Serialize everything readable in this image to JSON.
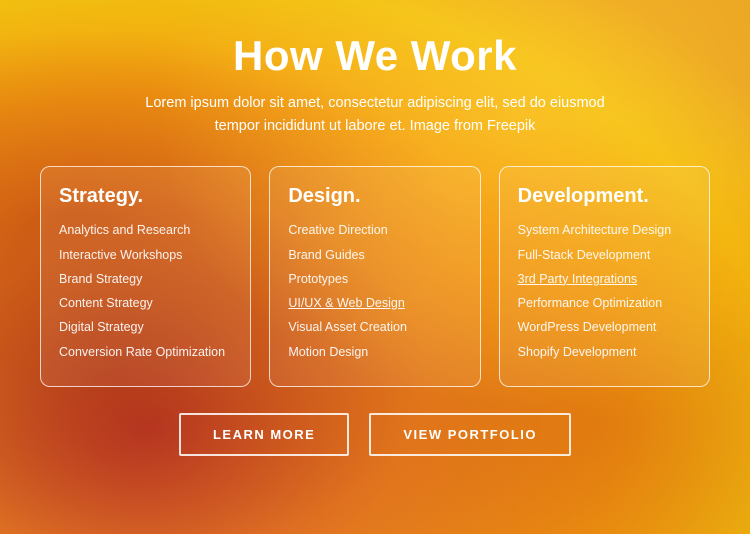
{
  "header": {
    "title": "How We Work",
    "subtitle_line1": "Lorem ipsum dolor sit amet, consectetur adipiscing elit, sed do eiusmod",
    "subtitle_line2": "tempor incididunt ut labore et. Image from Freepik"
  },
  "cards": [
    {
      "id": "strategy",
      "title": "Strategy.",
      "items": [
        {
          "text": "Analytics and Research",
          "underline": false
        },
        {
          "text": "Interactive Workshops",
          "underline": false
        },
        {
          "text": "Brand Strategy",
          "underline": false
        },
        {
          "text": "Content Strategy",
          "underline": false
        },
        {
          "text": "Digital Strategy",
          "underline": false
        },
        {
          "text": "Conversion Rate Optimization",
          "underline": false
        }
      ]
    },
    {
      "id": "design",
      "title": "Design.",
      "items": [
        {
          "text": "Creative Direction",
          "underline": false
        },
        {
          "text": "Brand Guides",
          "underline": false
        },
        {
          "text": "Prototypes",
          "underline": false
        },
        {
          "text": "UI/UX & Web Design",
          "underline": true
        },
        {
          "text": "Visual Asset Creation",
          "underline": false
        },
        {
          "text": "Motion Design",
          "underline": false
        }
      ]
    },
    {
      "id": "development",
      "title": "Development.",
      "items": [
        {
          "text": "System Architecture Design",
          "underline": false
        },
        {
          "text": "Full-Stack Development",
          "underline": false
        },
        {
          "text": "3rd Party Integrations",
          "underline": true
        },
        {
          "text": "Performance Optimization",
          "underline": false
        },
        {
          "text": "WordPress Development",
          "underline": false
        },
        {
          "text": "Shopify Development",
          "underline": false
        }
      ]
    }
  ],
  "buttons": [
    {
      "id": "learn-more",
      "label": "LEARN MORE"
    },
    {
      "id": "view-portfolio",
      "label": "VIEW PORTFOLIO"
    }
  ]
}
